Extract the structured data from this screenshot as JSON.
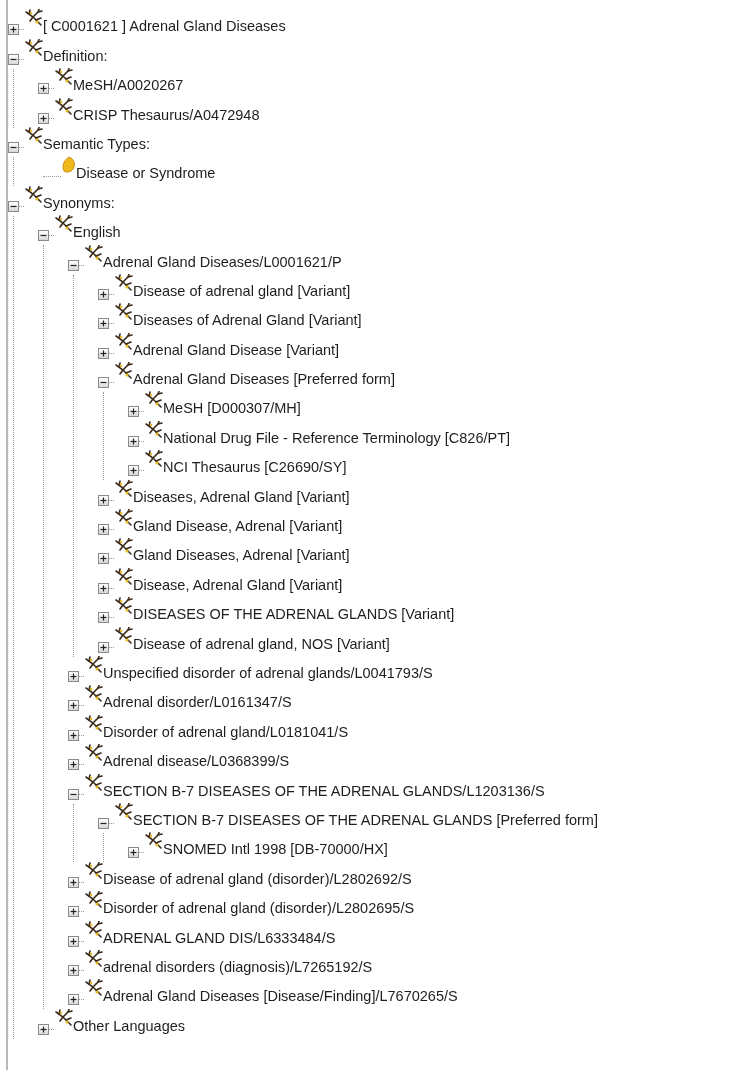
{
  "tree": [
    {
      "label": "[ C0001621 ] Adrenal Gland Diseases",
      "kind": "concept",
      "expanded": false
    },
    {
      "label": "Definition:",
      "kind": "concept",
      "expanded": true,
      "children": [
        {
          "label": "MeSH/A0020267",
          "kind": "concept",
          "expanded": false
        },
        {
          "label": "CRISP Thesaurus/A0472948",
          "kind": "concept",
          "expanded": false
        }
      ]
    },
    {
      "label": "Semantic Types:",
      "kind": "concept",
      "expanded": true,
      "children": [
        {
          "label": "Disease or Syndrome",
          "kind": "semantic-type"
        }
      ]
    },
    {
      "label": "Synonyms:",
      "kind": "concept",
      "expanded": true,
      "children": [
        {
          "label": "English",
          "kind": "concept",
          "expanded": true,
          "children": [
            {
              "label": "Adrenal Gland Diseases/L0001621/P",
              "kind": "concept",
              "expanded": true,
              "children": [
                {
                  "label": "Disease of adrenal gland [Variant]",
                  "kind": "concept",
                  "expanded": false
                },
                {
                  "label": "Diseases of Adrenal Gland [Variant]",
                  "kind": "concept",
                  "expanded": false
                },
                {
                  "label": "Adrenal Gland Disease [Variant]",
                  "kind": "concept",
                  "expanded": false
                },
                {
                  "label": "Adrenal Gland Diseases [Preferred form]",
                  "kind": "concept",
                  "expanded": true,
                  "children": [
                    {
                      "label": "MeSH [D000307/MH]",
                      "kind": "concept",
                      "expanded": false
                    },
                    {
                      "label": "National Drug File - Reference Terminology [C826/PT]",
                      "kind": "concept",
                      "expanded": false
                    },
                    {
                      "label": "NCI Thesaurus [C26690/SY]",
                      "kind": "concept",
                      "expanded": false
                    }
                  ]
                },
                {
                  "label": "Diseases, Adrenal Gland [Variant]",
                  "kind": "concept",
                  "expanded": false
                },
                {
                  "label": "Gland Disease, Adrenal [Variant]",
                  "kind": "concept",
                  "expanded": false
                },
                {
                  "label": "Gland Diseases, Adrenal [Variant]",
                  "kind": "concept",
                  "expanded": false
                },
                {
                  "label": "Disease, Adrenal Gland [Variant]",
                  "kind": "concept",
                  "expanded": false
                },
                {
                  "label": "DISEASES OF THE ADRENAL GLANDS [Variant]",
                  "kind": "concept",
                  "expanded": false
                },
                {
                  "label": "Disease of adrenal gland, NOS [Variant]",
                  "kind": "concept",
                  "expanded": false
                }
              ]
            },
            {
              "label": "Unspecified disorder of adrenal glands/L0041793/S",
              "kind": "concept",
              "expanded": false
            },
            {
              "label": "Adrenal disorder/L0161347/S",
              "kind": "concept",
              "expanded": false
            },
            {
              "label": "Disorder of adrenal gland/L0181041/S",
              "kind": "concept",
              "expanded": false
            },
            {
              "label": "Adrenal disease/L0368399/S",
              "kind": "concept",
              "expanded": false
            },
            {
              "label": "SECTION B-7 DISEASES OF THE ADRENAL GLANDS/L1203136/S",
              "kind": "concept",
              "expanded": true,
              "children": [
                {
                  "label": "SECTION B-7 DISEASES OF THE ADRENAL GLANDS [Preferred form]",
                  "kind": "concept",
                  "expanded": true,
                  "children": [
                    {
                      "label": "SNOMED Intl 1998 [DB-70000/HX]",
                      "kind": "concept",
                      "expanded": false
                    }
                  ]
                }
              ]
            },
            {
              "label": "Disease of adrenal gland (disorder)/L2802692/S",
              "kind": "concept",
              "expanded": false
            },
            {
              "label": "Disorder of adrenal gland (disorder)/L2802695/S",
              "kind": "concept",
              "expanded": false
            },
            {
              "label": "ADRENAL GLAND DIS/L6333484/S",
              "kind": "concept",
              "expanded": false
            },
            {
              "label": "adrenal disorders (diagnosis)/L7265192/S",
              "kind": "concept",
              "expanded": false
            },
            {
              "label": "Adrenal Gland Diseases [Disease/Finding]/L7670265/S",
              "kind": "concept",
              "expanded": false
            }
          ]
        },
        {
          "label": "Other Languages",
          "kind": "concept",
          "expanded": false
        }
      ]
    }
  ]
}
